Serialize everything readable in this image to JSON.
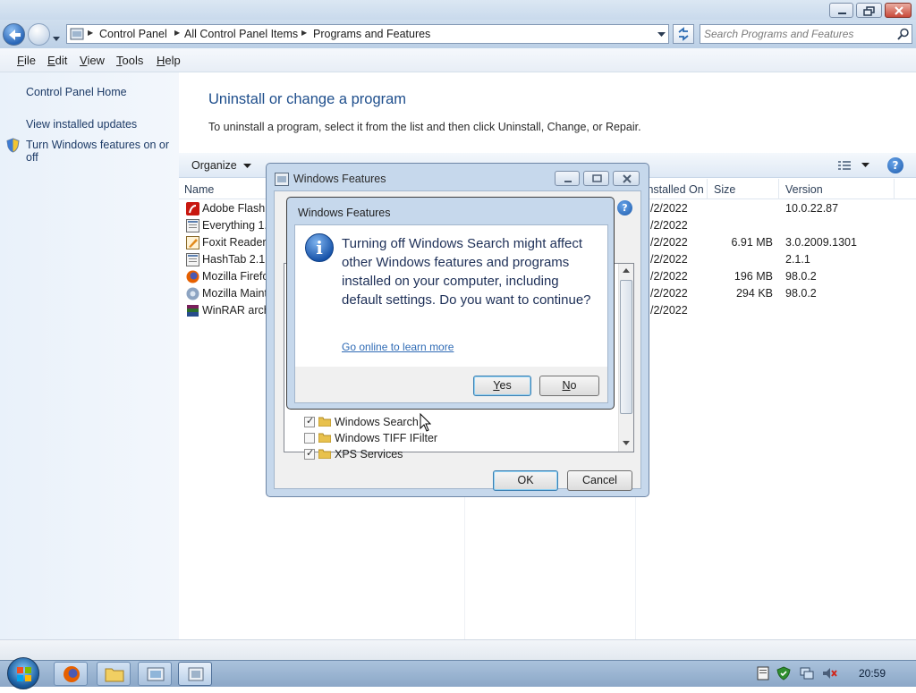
{
  "window": {
    "address": {
      "crumbs": [
        "Control Panel",
        "All Control Panel Items",
        "Programs and Features"
      ]
    },
    "search_placeholder": "Search Programs and Features"
  },
  "menu": [
    {
      "label": "File",
      "accel": "F",
      "rest": "ile"
    },
    {
      "label": "Edit",
      "accel": "E",
      "rest": "dit"
    },
    {
      "label": "View",
      "accel": "V",
      "rest": "iew"
    },
    {
      "label": "Tools",
      "accel": "T",
      "rest": "ools"
    },
    {
      "label": "Help",
      "accel": "H",
      "rest": "elp"
    }
  ],
  "left_pane": {
    "home": "Control Panel Home",
    "updates": "View installed updates",
    "features_line1": "Turn Windows features on or",
    "features_line2": "off"
  },
  "main": {
    "title": "Uninstall or change a program",
    "description": "To uninstall a program, select it from the list and then click Uninstall, Change, or Repair.",
    "organize": "Organize",
    "columns": {
      "name": "Name",
      "installed_on": "Installed On",
      "size": "Size",
      "version": "Version"
    },
    "programs": [
      {
        "name": "Adobe Flash P",
        "date": "/2/2022",
        "size": "",
        "version": "10.0.22.87",
        "icon": "flash-icon"
      },
      {
        "name": "Everything 1.2",
        "date": "/2/2022",
        "size": "",
        "version": "",
        "icon": "app-window-icon"
      },
      {
        "name": "Foxit Reader",
        "date": "/2/2022",
        "size": "6.91 MB",
        "version": "3.0.2009.1301",
        "icon": "foxit-icon"
      },
      {
        "name": "HashTab 2.1.1",
        "date": "/2/2022",
        "size": "",
        "version": "2.1.1",
        "icon": "app-window-icon"
      },
      {
        "name": "Mozilla Firefo",
        "date": "/2/2022",
        "size": "196 MB",
        "version": "98.0.2",
        "icon": "firefox-icon"
      },
      {
        "name": "Mozilla Maint",
        "date": "/2/2022",
        "size": "294 KB",
        "version": "98.0.2",
        "icon": "mozilla-maintenance-icon"
      },
      {
        "name": "WinRAR archi",
        "date": "/2/2022",
        "size": "",
        "version": "",
        "icon": "winrar-icon"
      }
    ]
  },
  "features_dialog": {
    "title": "Windows Features",
    "features": [
      {
        "label": "Windows Search",
        "checked": true
      },
      {
        "label": "Windows TIFF IFilter",
        "checked": false
      },
      {
        "label": "XPS Services",
        "checked": true
      }
    ],
    "ok": "OK",
    "cancel": "Cancel"
  },
  "confirm_dialog": {
    "title": "Windows Features",
    "message": "Turning off Windows Search might affect other Windows features and programs installed on your computer, including default settings. Do you want to continue?",
    "link": "Go online to learn more",
    "yes_accel": "Y",
    "yes_rest": "es",
    "no_accel": "N",
    "no_rest": "o"
  },
  "taskbar": {
    "clock": "20:59"
  },
  "colors": {
    "accent_blue": "#1e4e8c",
    "link_blue": "#2f6bb5",
    "title_bar": "#c9daec"
  }
}
